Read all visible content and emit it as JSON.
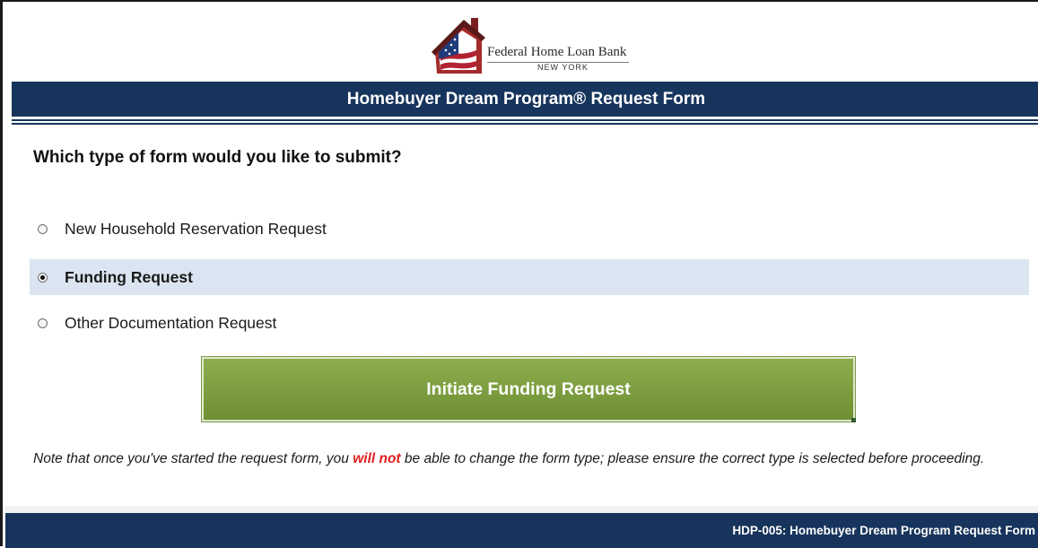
{
  "logo": {
    "name": "Federal Home Loan Bank",
    "location": "NEW YORK"
  },
  "header": {
    "title": "Homebuyer Dream Program® Request Form"
  },
  "form": {
    "question": "Which type of form would you like to submit?",
    "options": [
      {
        "label": "New Household Reservation Request",
        "selected": false
      },
      {
        "label": "Funding Request",
        "selected": true
      },
      {
        "label": "Other Documentation Request",
        "selected": false
      }
    ],
    "submit_label": "Initiate Funding Request"
  },
  "note": {
    "before": "Note that once you've started the request form, you ",
    "emphasis": "will not",
    "after": "  be able to change the form type; please ensure the correct type is selected before proceeding."
  },
  "footer": {
    "form_id": "HDP-005: Homebuyer Dream Program Request Form"
  },
  "colors": {
    "navy": "#17345c",
    "selected_row": "#dbe5f1",
    "button_green": "#7a9a45",
    "warning_red": "#e01f1f"
  }
}
